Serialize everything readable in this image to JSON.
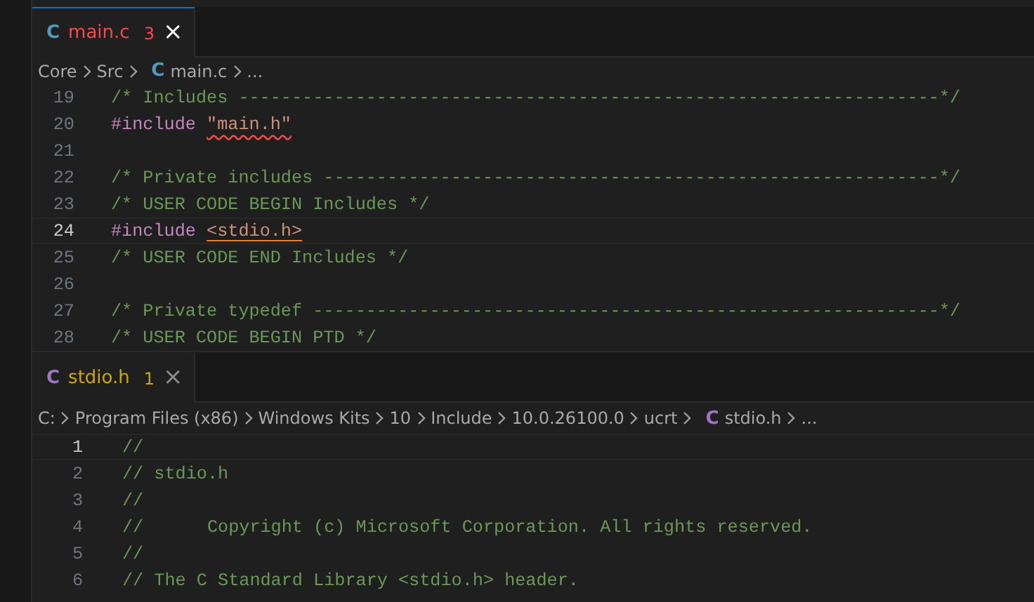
{
  "panes": [
    {
      "focused": true,
      "tab": {
        "icon": "C",
        "label": "main.c",
        "error": true,
        "count": "3",
        "color": "#519aba",
        "close": "×"
      },
      "breadcrumbs": [
        {
          "label": "Core",
          "kind": "text"
        },
        {
          "label": "Src",
          "kind": "text"
        },
        {
          "icon": "C",
          "label": "main.c",
          "kind": "file",
          "color": "#519aba"
        },
        {
          "label": "...",
          "kind": "text"
        }
      ],
      "lines": [
        {
          "number": "19",
          "current": false,
          "tokens": [
            {
              "text": "/* Includes ------------------------------------------------------------------*/",
              "kind": "comment"
            }
          ]
        },
        {
          "number": "20",
          "current": false,
          "tokens": [
            {
              "text": "#include ",
              "kind": "keyword"
            },
            {
              "text": "\"main.h\"",
              "kind": "string",
              "error": true
            }
          ]
        },
        {
          "number": "21",
          "current": false
        },
        {
          "number": "22",
          "current": false,
          "tokens": [
            {
              "text": "/* Private includes ----------------------------------------------------------*/",
              "kind": "comment"
            }
          ]
        },
        {
          "number": "23",
          "current": false,
          "tokens": [
            {
              "text": "/* USER CODE BEGIN Includes */",
              "kind": "comment"
            }
          ]
        },
        {
          "number": "24",
          "current": true,
          "tokens": [
            {
              "text": "#include ",
              "kind": "keyword"
            },
            {
              "text": "<stdio.h>",
              "kind": "string",
              "error": false
            }
          ]
        },
        {
          "number": "25",
          "current": false,
          "tokens": [
            {
              "text": "/* USER CODE END Includes */",
              "kind": "comment"
            }
          ]
        },
        {
          "number": "26",
          "current": false
        },
        {
          "number": "27",
          "current": false,
          "tokens": [
            {
              "text": "/* Private typedef -----------------------------------------------------------*/",
              "kind": "comment"
            }
          ]
        },
        {
          "number": "28",
          "current": false,
          "tokens": [
            {
              "text": "/* USER CODE BEGIN PTD */",
              "kind": "comment"
            }
          ]
        }
      ]
    },
    {
      "focused": false,
      "tab": {
        "icon": "C",
        "label": "stdio.h",
        "error": false,
        "count": "1",
        "color": "#a074c4",
        "close": "×"
      },
      "breadcrumbs": [
        {
          "label": "C:",
          "kind": "text"
        },
        {
          "label": "Program Files (x86)",
          "kind": "text"
        },
        {
          "label": "Windows Kits",
          "kind": "text"
        },
        {
          "label": "10",
          "kind": "text"
        },
        {
          "label": "Include",
          "kind": "text"
        },
        {
          "label": "10.0.26100.0",
          "kind": "text"
        },
        {
          "label": "ucrt",
          "kind": "text"
        },
        {
          "icon": "C",
          "label": "stdio.h",
          "kind": "file",
          "color": "#a074c4"
        },
        {
          "label": "...",
          "kind": "text"
        }
      ],
      "lines": [
        {
          "number": "1",
          "current": true,
          "tokens": [
            {
              "text": "//",
              "kind": "comment"
            }
          ]
        },
        {
          "number": "2",
          "current": false,
          "tokens": [
            {
              "text": "// stdio.h",
              "kind": "comment"
            }
          ]
        },
        {
          "number": "3",
          "current": false,
          "tokens": [
            {
              "text": "//",
              "kind": "comment"
            }
          ]
        },
        {
          "number": "4",
          "current": false,
          "tokens": [
            {
              "text": "//      Copyright (c) Microsoft Corporation. All rights reserved.",
              "kind": "comment"
            }
          ]
        },
        {
          "number": "5",
          "current": false,
          "tokens": [
            {
              "text": "//",
              "kind": "comment"
            }
          ]
        },
        {
          "number": "6",
          "current": false,
          "tokens": [
            {
              "text": "// The C Standard Library <stdio.h> header.",
              "kind": "comment"
            }
          ]
        }
      ]
    }
  ]
}
